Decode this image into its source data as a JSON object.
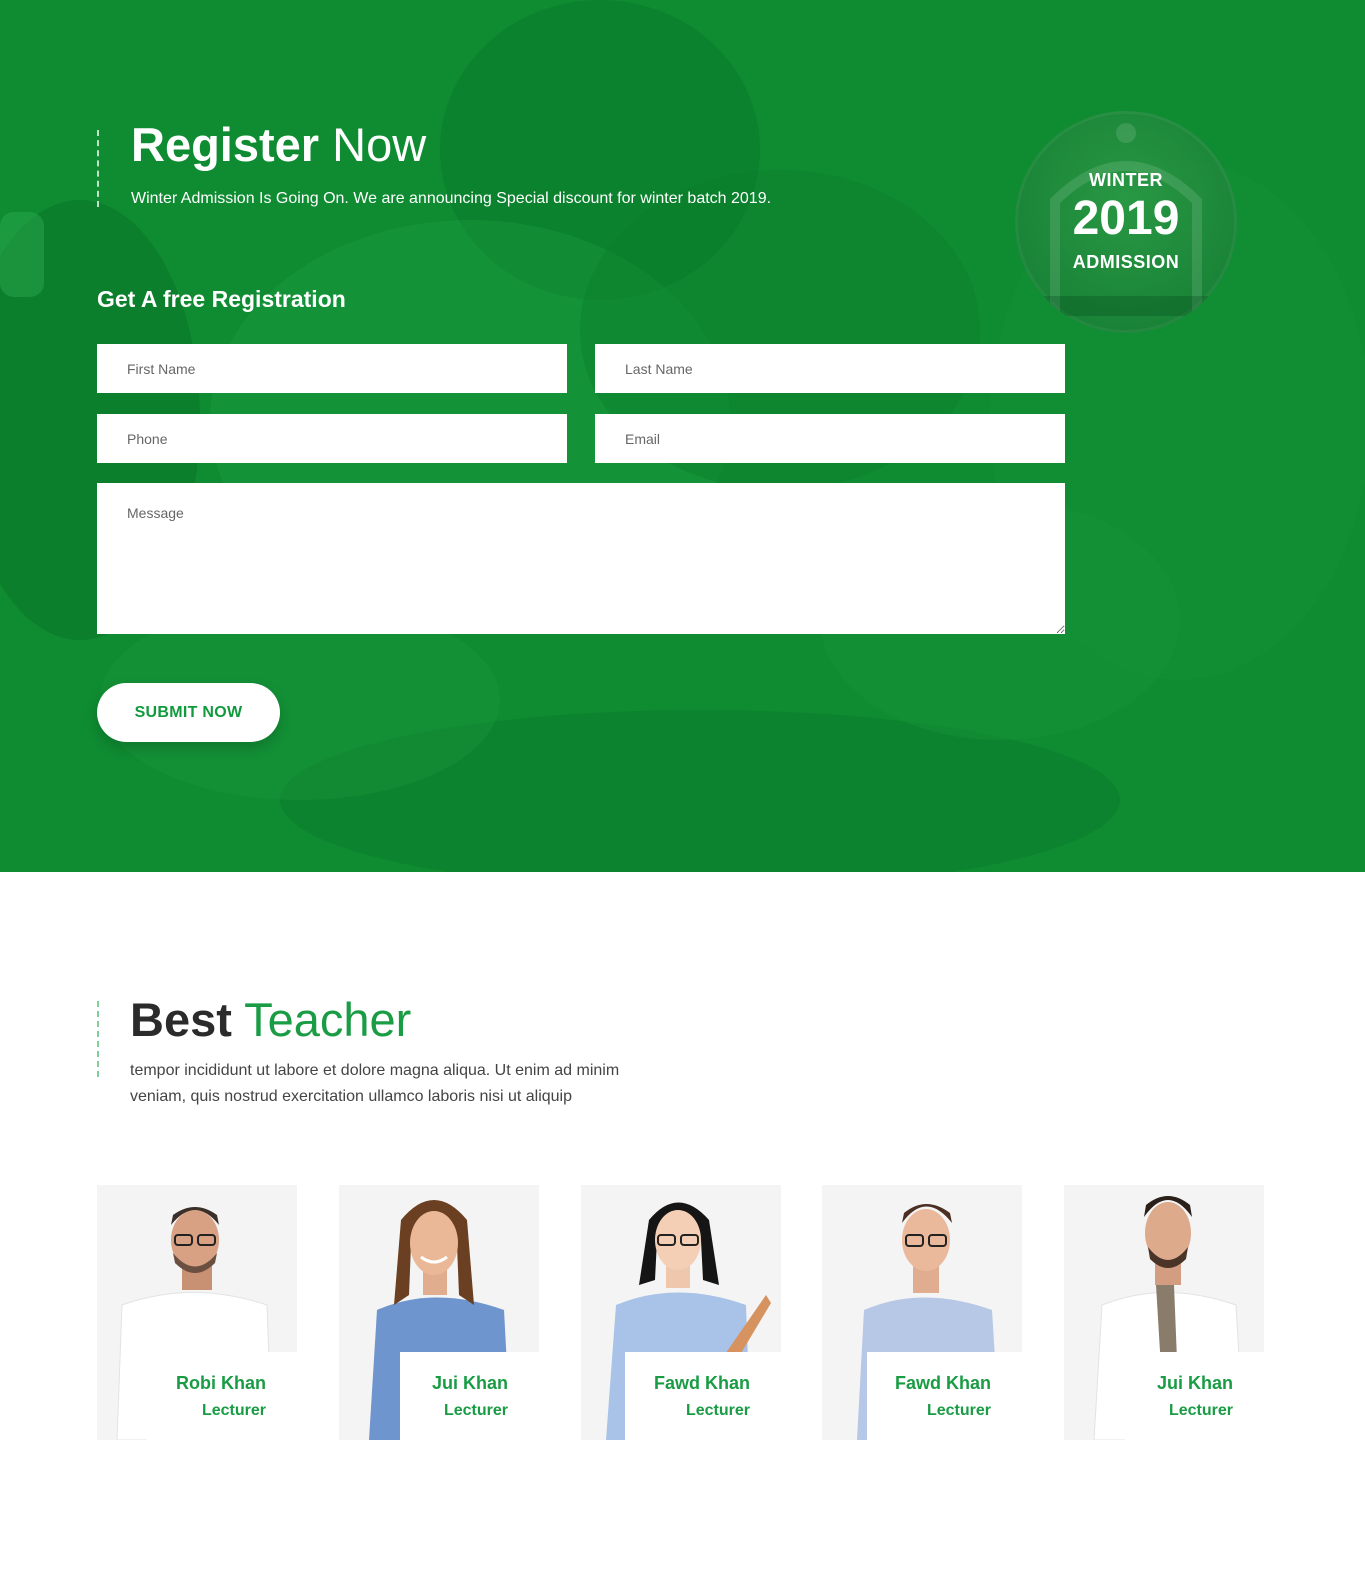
{
  "register": {
    "title_bold": "Register",
    "title_light": " Now",
    "subtitle": "Winter Admission Is Going On. We are announcing Special discount for winter batch 2019.",
    "badge": {
      "line1": "WINTER",
      "line2": "2019",
      "line3": "ADMISSION"
    },
    "form_title": "Get A free Registration",
    "fields": {
      "first_name": "First Name",
      "last_name": "Last Name",
      "phone": "Phone",
      "email": "Email",
      "message": "Message"
    },
    "submit_label": "SUBMIT NOW"
  },
  "teachers": {
    "title_bold": "Best",
    "title_accent": " Teacher",
    "description": "tempor incididunt ut labore et dolore magna aliqua. Ut enim ad minim veniam, quis nostrud exercitation ullamco laboris nisi ut aliquip",
    "items": [
      {
        "name": "Robi Khan",
        "role": "Lecturer"
      },
      {
        "name": "Jui Khan",
        "role": "Lecturer"
      },
      {
        "name": "Fawd Khan",
        "role": "Lecturer"
      },
      {
        "name": "Fawd Khan",
        "role": "Lecturer"
      },
      {
        "name": "Jui Khan",
        "role": "Lecturer"
      }
    ]
  },
  "colors": {
    "brand_green": "#0f8c32",
    "accent_green": "#1a9c45",
    "white": "#ffffff"
  }
}
